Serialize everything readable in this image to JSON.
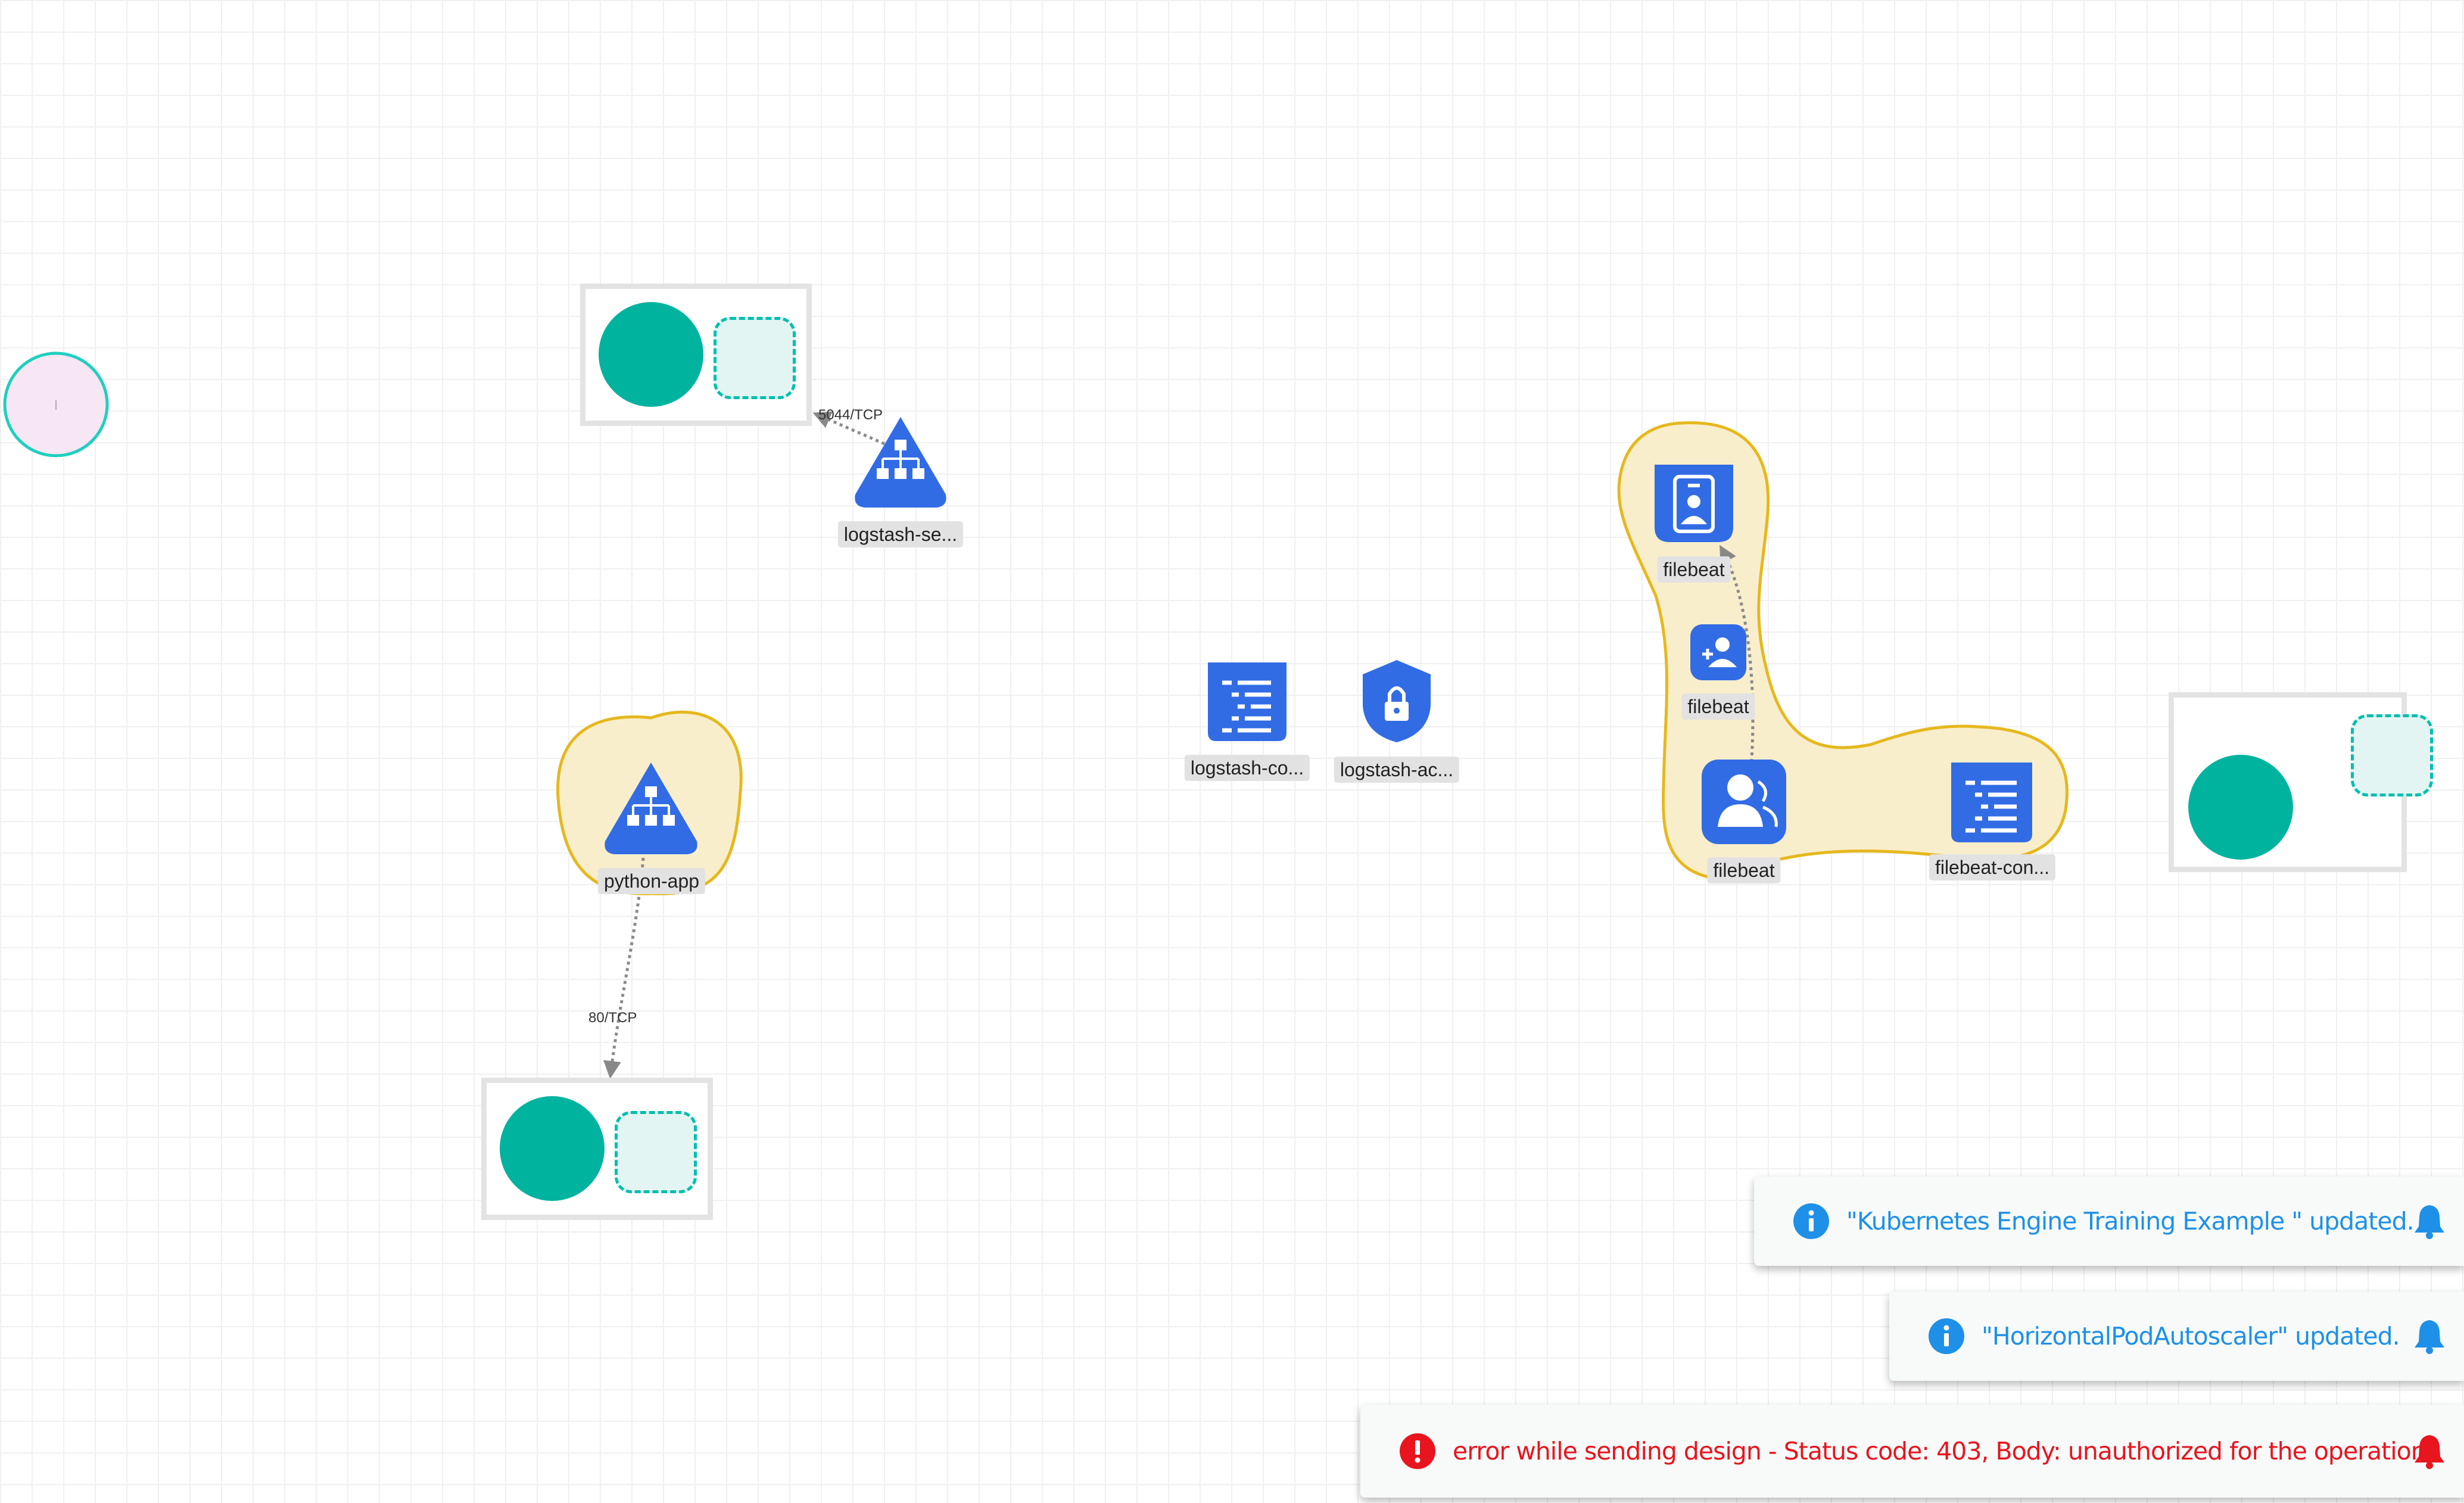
{
  "canvas": {
    "grid_color": "#f0f0f0",
    "accent_teal": "#00b39f",
    "icon_blue": "#326ce5",
    "group_fill": "#f9eecb",
    "group_stroke": "#e6b81e"
  },
  "nodes": {
    "logstash_service": "logstash-se...",
    "python_app": "python-app",
    "logstash_configmap": "logstash-co...",
    "logstash_account": "logstash-ac...",
    "filebeat_role": "filebeat",
    "filebeat_binding": "filebeat",
    "filebeat_account": "filebeat",
    "filebeat_configmap": "filebeat-con..."
  },
  "edges": {
    "logstash_port": "5044/TCP",
    "python_port": "80/TCP"
  },
  "toasts": [
    {
      "type": "info",
      "icon": "info-icon",
      "message": "\"Kubernetes Engine Training Example \" updated.",
      "color": "#1e90e8"
    },
    {
      "type": "info",
      "icon": "info-icon",
      "message": "\"HorizontalPodAutoscaler\" updated.",
      "color": "#1e90e8"
    },
    {
      "type": "error",
      "icon": "error-icon",
      "message": "error while sending design - Status code: 403, Body: unauthorized for the operation",
      "color": "#e8141e"
    }
  ]
}
